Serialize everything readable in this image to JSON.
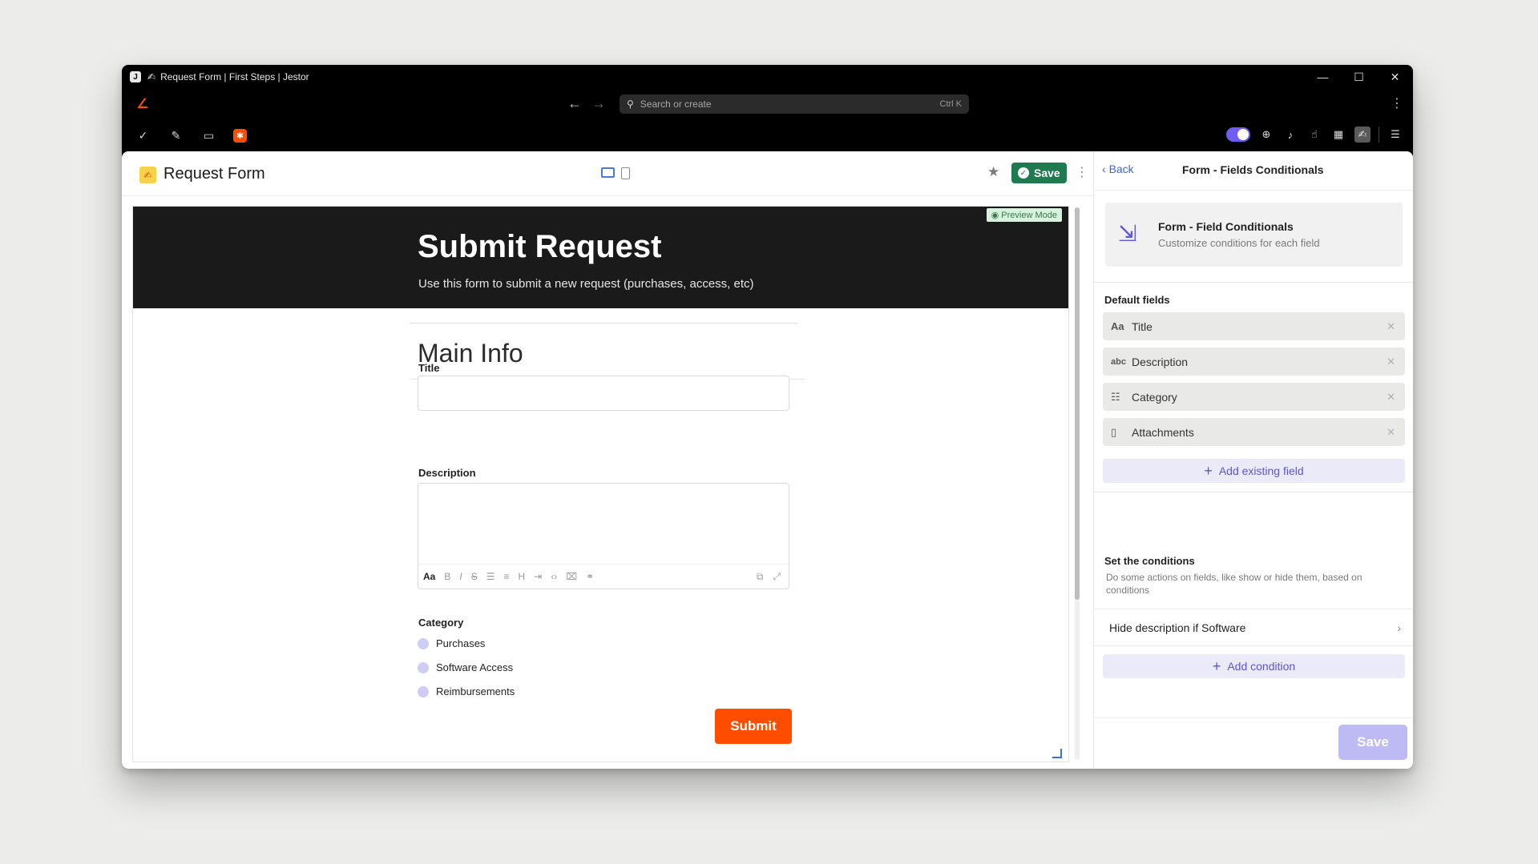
{
  "window": {
    "tab_title": "Request Form | First Steps | Jestor",
    "minimize": "—",
    "maximize": "☐",
    "close": "✕"
  },
  "addressbar": {
    "search_placeholder": "Search or create",
    "shortcut": "Ctrl K"
  },
  "page": {
    "title": "Request Form",
    "save_label": "Save"
  },
  "form": {
    "preview_badge": "Preview Mode",
    "heading": "Submit Request",
    "subheading": "Use this form to submit a new request (purchases, access, etc)",
    "section_title": "Main Info",
    "title_label": "Title",
    "description_label": "Description",
    "category_label": "Category",
    "category_options": [
      "Purchases",
      "Software Access",
      "Reimbursements"
    ],
    "submit_label": "Submit",
    "rte_format": "Aa"
  },
  "panel": {
    "back_label": "Back",
    "title": "Form - Fields Conditionals",
    "card_title": "Form - Field Conditionals",
    "card_subtitle": "Customize conditions for each field",
    "default_fields_heading": "Default fields",
    "fields": [
      {
        "label": "Title",
        "icon": "Aa"
      },
      {
        "label": "Description",
        "icon": "abc"
      },
      {
        "label": "Category",
        "icon": "list-icon"
      },
      {
        "label": "Attachments",
        "icon": "file-icon"
      }
    ],
    "add_existing_field": "Add existing field",
    "conditions_heading": "Set the conditions",
    "conditions_description": "Do some actions on fields, like show or hide them, based on conditions",
    "condition_item": "Hide description if Software",
    "add_condition": "Add condition",
    "save_label": "Save"
  },
  "colors": {
    "accent_orange": "#ff4d00",
    "save_green": "#1f7a4f",
    "accent_purple": "#5a55d8"
  }
}
